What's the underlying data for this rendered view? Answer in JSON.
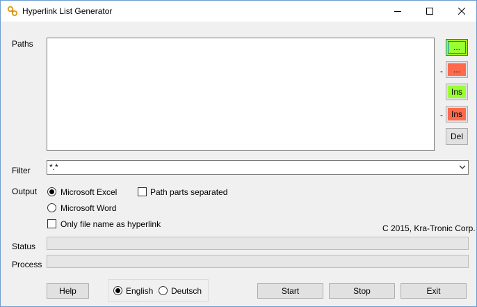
{
  "window": {
    "title": "Hyperlink List Generator"
  },
  "title_controls": {
    "minimize": "minimize-icon",
    "maximize": "maximize-icon",
    "close": "close-icon"
  },
  "labels": {
    "paths": "Paths",
    "filter": "Filter",
    "output": "Output",
    "status": "Status",
    "process": "Process"
  },
  "paths": {
    "items": []
  },
  "side_buttons": {
    "add_browse": "...",
    "remove_browse_prefix": "-",
    "remove_browse": "...",
    "insert": "Ins",
    "remove_insert_prefix": "-",
    "remove_insert": "Ins",
    "delete": "Del"
  },
  "filter": {
    "value": "*.*"
  },
  "output": {
    "excel": "Microsoft Excel",
    "word": "Microsoft Word",
    "path_parts": "Path parts separated",
    "only_file_name": "Only file name as hyperlink",
    "selected": "excel"
  },
  "copyright": "C 2015, Kra-Tronic Corp.",
  "status": {
    "value": ""
  },
  "process": {
    "progress": 0
  },
  "language": {
    "english": "English",
    "deutsch": "Deutsch",
    "selected": "english"
  },
  "buttons": {
    "help": "Help",
    "start": "Start",
    "stop": "Stop",
    "exit": "Exit"
  },
  "colors": {
    "green": "#99ff33",
    "red": "#ff6a4d",
    "focus": "#0078d7"
  }
}
